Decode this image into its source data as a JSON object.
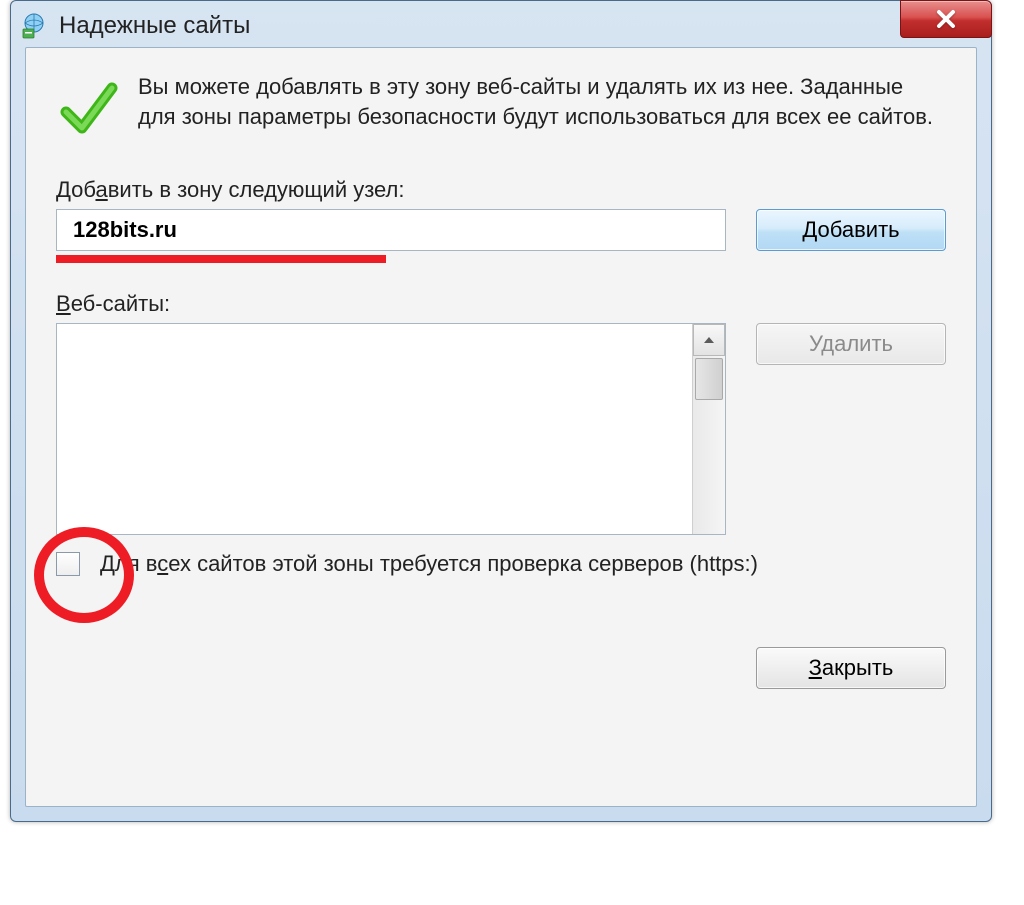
{
  "window": {
    "title": "Надежные сайты"
  },
  "header": {
    "description": "Вы можете добавлять в эту зону веб-сайты и удалять их из нее. Заданные для зоны параметры безопасности будут использоваться для всех ее сайтов."
  },
  "add": {
    "label_pre": "Доб",
    "label_u": "а",
    "label_post": "вить в зону следующий узел:",
    "value": "128bits.ru",
    "button": "Добавить"
  },
  "list": {
    "label_u": "В",
    "label_post": "еб-сайты:",
    "remove_button": "Удалить"
  },
  "checkbox": {
    "label_pre": "Для в",
    "label_u": "с",
    "label_post": "ех сайтов этой зоны требуется проверка серверов (https:)",
    "checked": false
  },
  "actions": {
    "close_u": "З",
    "close_post": "акрыть"
  }
}
